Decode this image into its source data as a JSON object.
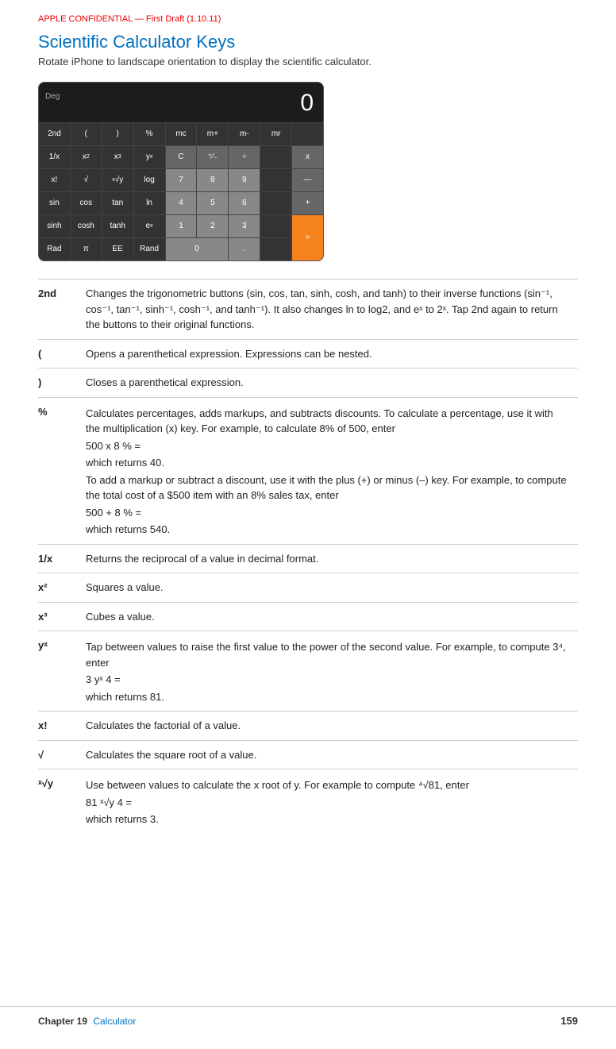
{
  "confidential": "APPLE CONFIDENTIAL — First Draft (1.10.11)",
  "title": "Scientific Calculator Keys",
  "subtitle": "Rotate iPhone to landscape orientation to display the scientific calculator.",
  "calc": {
    "display_value": "0",
    "deg_label": "Deg",
    "rows": [
      [
        "2nd",
        "(",
        ")",
        "%",
        "mc",
        "m+",
        "m-",
        "mr",
        ""
      ],
      [
        "1/x",
        "x²",
        "x³",
        "yˣ",
        "C",
        "⁺∕₋",
        "÷",
        "",
        "x"
      ],
      [
        "x!",
        "√",
        "ˣ√y",
        "log",
        "7",
        "8",
        "9",
        "",
        "—"
      ],
      [
        "sin",
        "cos",
        "tan",
        "ln",
        "4",
        "5",
        "6",
        "",
        "+"
      ],
      [
        "sinh",
        "cosh",
        "tanh",
        "eˣ",
        "1",
        "2",
        "3",
        "",
        ""
      ],
      [
        "Rad",
        "π",
        "EE",
        "Rand",
        "0",
        "",
        ".",
        "",
        " ="
      ]
    ]
  },
  "table": {
    "rows": [
      {
        "key": "2nd",
        "desc": "Changes the trigonometric buttons (sin, cos, tan, sinh, cosh, and tanh) to their inverse functions (sin⁻¹, cos⁻¹, tan⁻¹, sinh⁻¹, cosh⁻¹, and tanh⁻¹). It also changes ln to log2, and eˣ to 2ˣ. Tap 2nd again to return the buttons to their original functions."
      },
      {
        "key": "(",
        "desc": "Opens a parenthetical expression. Expressions can be nested."
      },
      {
        "key": ")",
        "desc": "Closes a parenthetical expression."
      },
      {
        "key": "%",
        "desc_parts": [
          "Calculates percentages, adds markups, and subtracts discounts. To calculate a percentage, use it with the multiplication (x) key. For example, to calculate 8% of 500, enter",
          "500 x 8 % =",
          "which returns 40.",
          "To add a markup or subtract a discount, use it with the plus (+) or minus (–) key. For example, to compute the total cost of a $500 item with an 8% sales tax, enter",
          "500 + 8 % =",
          "which returns 540."
        ]
      },
      {
        "key": "1/x",
        "desc": "Returns the reciprocal of a value in decimal format."
      },
      {
        "key": "x²",
        "desc": "Squares a value."
      },
      {
        "key": "x³",
        "desc": "Cubes a value."
      },
      {
        "key": "yˣ",
        "desc_parts": [
          "Tap between values to raise the first value to the power of the second value. For example, to compute 3⁴, enter",
          "3 yˣ 4 =",
          "which returns 81."
        ]
      },
      {
        "key": "x!",
        "desc": "Calculates the factorial of a value."
      },
      {
        "key": "√",
        "desc": "Calculates the square root of a value."
      },
      {
        "key": "ˣ√y",
        "desc_parts": [
          "Use between values to calculate the x root of y. For example to compute ⁴√81, enter",
          "81 ˣ√y 4 =",
          "which returns 3."
        ]
      }
    ]
  },
  "footer": {
    "chapter_label": "Chapter",
    "chapter_number": "19",
    "chapter_name": "Calculator",
    "page_number": "159"
  }
}
